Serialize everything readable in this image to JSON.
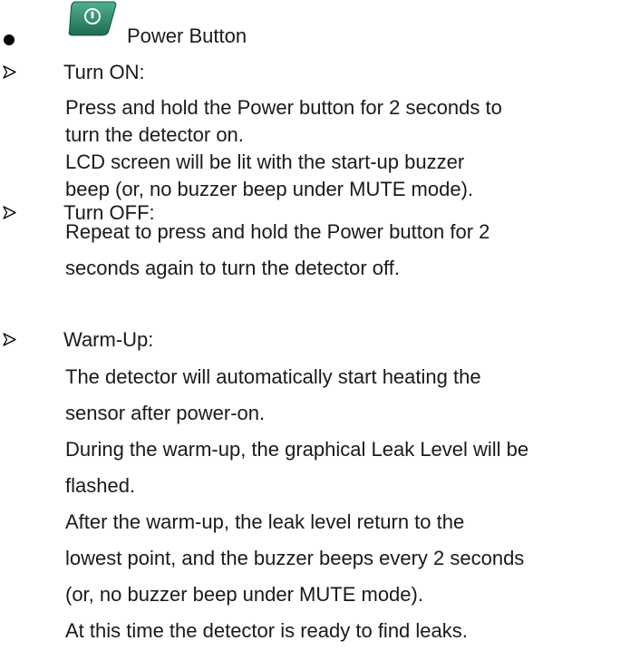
{
  "colors": {
    "icon_green": "#2f8f72",
    "icon_green_dark": "#1e6b54",
    "text": "#1a1a1a"
  },
  "power_button": {
    "icon": "power-icon",
    "label": "Power Button"
  },
  "turn_on": {
    "title": "Turn ON:",
    "lines": [
      "Press and hold the Power button for 2 seconds to",
      "turn the detector on.",
      "LCD screen will be lit with the start-up buzzer",
      "beep (or, no buzzer beep under MUTE mode)."
    ]
  },
  "turn_off": {
    "title": "Turn OFF:",
    "lines": [
      "Repeat to press and hold the Power button for 2",
      "seconds again to turn the detector off."
    ]
  },
  "warm_up": {
    "title": "Warm-Up:",
    "lines": [
      "The detector will automatically start heating the",
      "sensor after power-on.",
      "During the warm-up, the graphical Leak Level will be",
      "flashed.",
      "After the warm-up, the leak level return to the",
      "lowest point, and the buzzer beeps every 2 seconds",
      "(or, no buzzer beep under MUTE mode).",
      "At this time the detector is ready to find leaks."
    ]
  }
}
